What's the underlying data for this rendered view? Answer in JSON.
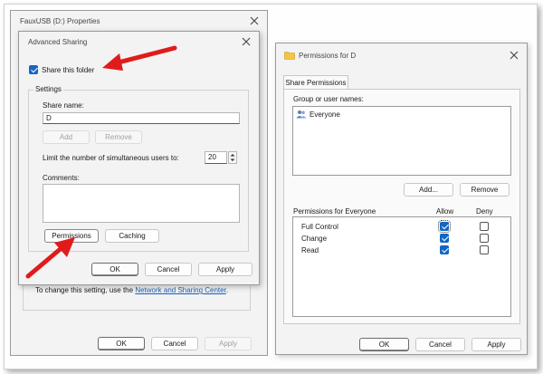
{
  "properties_window": {
    "title": "FauxUSB (D:) Properties",
    "info_text": "To change this setting, use the",
    "link_text": "Network and Sharing Center",
    "link_suffix": ".",
    "ok_label": "OK",
    "cancel_label": "Cancel",
    "apply_label": "Apply"
  },
  "advanced_sharing": {
    "title": "Advanced Sharing",
    "share_checkbox_label": "Share this folder",
    "share_checked": true,
    "settings_group_label": "Settings",
    "share_name_label": "Share name:",
    "share_name_value": "D",
    "add_label": "Add",
    "remove_label": "Remove",
    "limit_label": "Limit the number of simultaneous users to:",
    "limit_value": "20",
    "comments_label": "Comments:",
    "permissions_label": "Permissions",
    "caching_label": "Caching",
    "ok_label": "OK",
    "cancel_label": "Cancel",
    "apply_label": "Apply"
  },
  "permissions_dialog": {
    "title": "Permissions for D",
    "tab_label": "Share Permissions",
    "group_label": "Group or user names:",
    "users": [
      "Everyone"
    ],
    "add_label": "Add...",
    "remove_label": "Remove",
    "perm_header": "Permissions for Everyone",
    "allow_header": "Allow",
    "deny_header": "Deny",
    "permissions": [
      {
        "name": "Full Control",
        "allow": true,
        "deny": false
      },
      {
        "name": "Change",
        "allow": true,
        "deny": false
      },
      {
        "name": "Read",
        "allow": true,
        "deny": false
      }
    ],
    "ok_label": "OK",
    "cancel_label": "Cancel",
    "apply_label": "Apply"
  },
  "colors": {
    "accent": "#1266c4",
    "arrow": "#e11b1b",
    "link": "#1a5fb4"
  }
}
